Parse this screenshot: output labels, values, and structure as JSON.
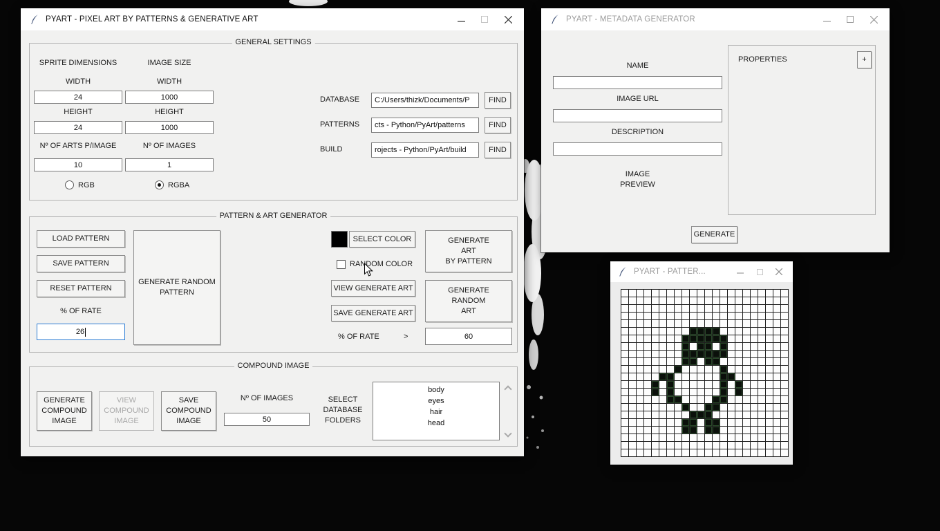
{
  "main_window": {
    "title": "PYART - PIXEL ART BY PATTERNS & GENERATIVE ART",
    "general_settings": {
      "legend": "GENERAL SETTINGS",
      "sprite_dimensions_label": "SPRITE DIMENSIONS",
      "image_size_label": "IMAGE SIZE",
      "sprite_width_label": "WIDTH",
      "sprite_width": "24",
      "sprite_height_label": "HEIGHT",
      "sprite_height": "24",
      "image_width_label": "WIDTH",
      "image_width": "1000",
      "image_height_label": "HEIGHT",
      "image_height": "1000",
      "arts_per_image_label": "Nº OF ARTS P/IMAGE",
      "arts_per_image": "10",
      "num_images_label": "Nº OF IMAGES",
      "num_images": "1",
      "rgb_label": "RGB",
      "rgba_label": "RGBA",
      "database_label": "DATABASE",
      "database_value": "C:/Users/thizk/Documents/P",
      "patterns_label": "PATTERNS",
      "patterns_value": "cts - Python/PyArt/patterns",
      "build_label": "BUILD",
      "build_value": "rojects - Python/PyArt/build",
      "find_label": "FIND"
    },
    "pattern_generator": {
      "legend": "PATTERN & ART GENERATOR",
      "load_pattern": "LOAD PATTERN",
      "save_pattern": "SAVE PATTERN",
      "reset_pattern": "RESET PATTERN",
      "rate_label": "% OF RATE",
      "rate_value": "26",
      "generate_random_pattern": "GENERATE RANDOM\nPATTERN",
      "swatch_color": "#000000",
      "select_color": "SELECT COLOR",
      "random_color": "RANDOM COLOR",
      "view_generate_art": "VIEW GENERATE ART",
      "save_generate_art": "SAVE GENERATE ART",
      "rate2_label": "% OF RATE",
      "rate2_arrow": ">",
      "rate2_value": "60",
      "generate_art_by_pattern": "GENERATE\nART\nBY PATTERN",
      "generate_random_art": "GENERATE\nRANDOM\nART"
    },
    "compound_image": {
      "legend": "COMPOUND IMAGE",
      "generate_compound": "GENERATE\nCOMPOUND\nIMAGE",
      "view_compound": "VIEW\nCOMPOUND\nIMAGE",
      "save_compound": "SAVE\nCOMPOUND\nIMAGE",
      "num_images_label": "Nº OF IMAGES",
      "num_images": "50",
      "select_folders_label": "SELECT\nDATABASE\nFOLDERS",
      "folders": [
        "body",
        "eyes",
        "hair",
        "head"
      ]
    }
  },
  "metadata_window": {
    "title": "PYART - METADATA GENERATOR",
    "name_label": "NAME",
    "name_value": "",
    "image_url_label": "IMAGE URL",
    "image_url_value": "",
    "description_label": "DESCRIPTION",
    "description_value": "",
    "image_preview_label": "IMAGE\nPREVIEW",
    "properties_label": "PROPERTIES",
    "add_property_label": "+",
    "generate_label": "GENERATE"
  },
  "pattern_window": {
    "title": "PYART - PATTER...",
    "grid_rows": 22,
    "grid_cols": 22,
    "filled_color": "#0b100b",
    "grid": [
      "......................",
      "......................",
      "......................",
      "......................",
      "......................",
      ".........####.........",
      "........######........",
      "........#.##.#........",
      "........######........",
      "........##.##.........",
      ".......#.....#........",
      ".....##......##.......",
      "....#.#......#.#......",
      "....#.#......#.#......",
      "......##....##........",
      "........#..##.........",
      ".........###..........",
      "........##.##.........",
      "........##.##.........",
      "......................",
      "......................",
      "......................"
    ]
  }
}
